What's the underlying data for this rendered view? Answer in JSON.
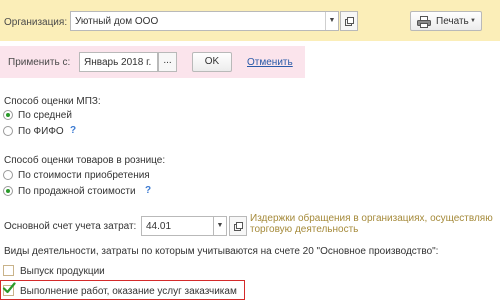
{
  "header": {
    "org_label": "Организация:",
    "org_value": "Уютный дом ООО",
    "print_label": "Печать"
  },
  "apply_bar": {
    "label": "Применить с:",
    "date_value": "Январь 2018 г.",
    "more": "...",
    "ok": "OK",
    "cancel": "Отменить"
  },
  "mpz": {
    "title": "Способ оценки МПЗ:",
    "opt1": "По средней",
    "opt2": "По ФИФО",
    "selected": "По средней"
  },
  "retail": {
    "title": "Способ оценки товаров в рознице:",
    "opt1": "По стоимости приобретения",
    "opt2": "По продажной стоимости",
    "selected": "По продажной стоимости"
  },
  "account": {
    "label": "Основной счет учета затрат:",
    "value": "44.01",
    "desc_line1": "Издержки обращения в организациях, осуществляю",
    "desc_line2": "торговую деятельность"
  },
  "activities": {
    "title": "Виды деятельности, затраты по которым учитываются на счете 20 \"Основное производство\":",
    "item1": "Выпуск продукции",
    "item1_checked": false,
    "item2": "Выполнение работ, оказание услуг заказчикам",
    "item2_checked": true
  },
  "help_mark": "?",
  "colors": {
    "top_bar": "#fbeeb8",
    "apply_bar": "#fbe4ec",
    "link": "#2a5aa8",
    "help": "#3c7ad1",
    "radio_on": "#2a9a2a",
    "check": "#2a9a2a",
    "highlight": "#d42a2a",
    "account_desc": "#a58a3a"
  },
  "icons": {
    "open": "open-form-icon",
    "printer": "printer-icon",
    "dropdown": "chevron-down-icon",
    "checkmark": "checkmark-icon"
  }
}
